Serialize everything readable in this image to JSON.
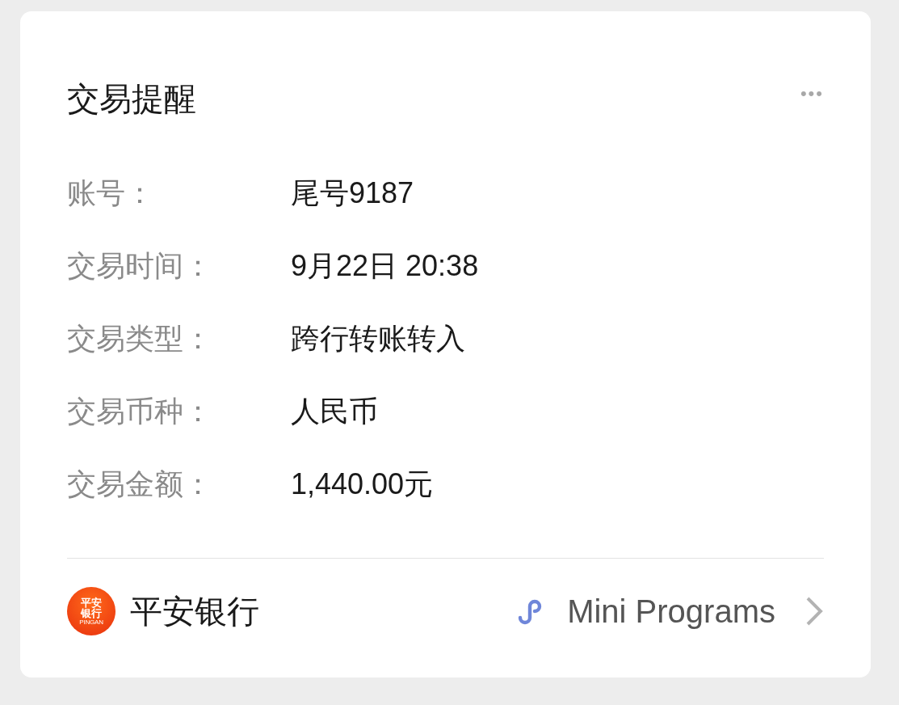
{
  "card": {
    "title": "交易提醒",
    "more": "•••",
    "fields": [
      {
        "label": "账号：",
        "value": "尾号9187"
      },
      {
        "label": "交易时间：",
        "value": "9月22日 20:38"
      },
      {
        "label": "交易类型：",
        "value": "跨行转账转入"
      },
      {
        "label": "交易币种：",
        "value": "人民币"
      },
      {
        "label": "交易金额：",
        "value": "1,440.00元"
      }
    ],
    "footer": {
      "logo_lines": [
        "平安",
        "银行",
        "PINGAN"
      ],
      "bank_name": "平安银行",
      "link": "Mini Programs"
    }
  }
}
